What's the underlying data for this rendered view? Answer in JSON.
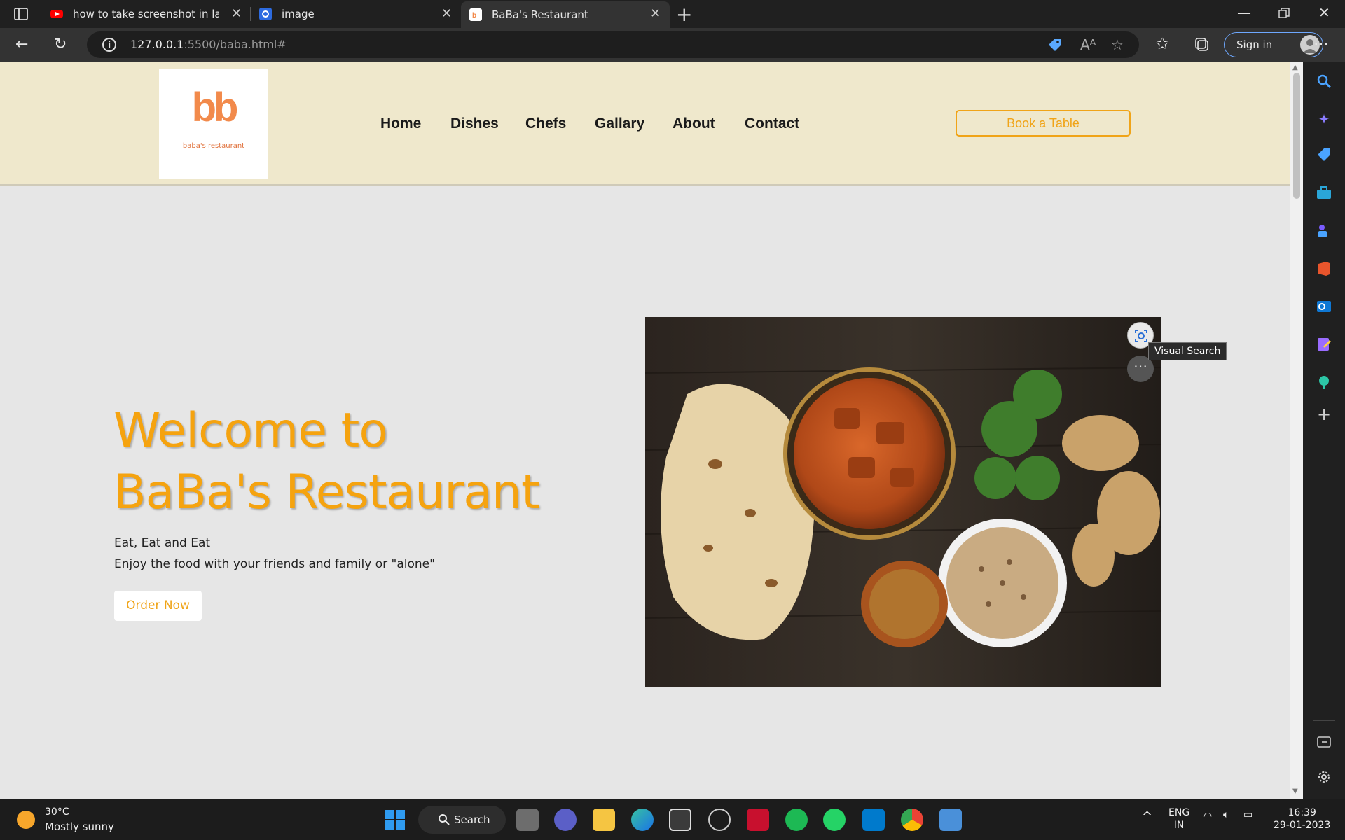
{
  "browser": {
    "tabs": [
      {
        "title": "how to take screenshot in laptop",
        "favicon": "youtube-icon",
        "color": "#ff0000"
      },
      {
        "title": "image",
        "favicon": "image-site-icon",
        "color": "#2d6be0"
      },
      {
        "title": "BaBa's Restaurant",
        "favicon": "restaurant-icon",
        "color": "#f28a4b",
        "active": true
      }
    ],
    "url_host": "127.0.0.1",
    "url_rest": ":5500/baba.html#",
    "sign_in_label": "Sign in"
  },
  "site": {
    "logo": {
      "mark": "bb",
      "subtitle": "baba's restaurant"
    },
    "nav": [
      "Home",
      "Dishes",
      "Chefs",
      "Gallary",
      "About",
      "Contact"
    ],
    "book_button": "Book a Table",
    "hero": {
      "title_line1": "Welcome to",
      "title_line2": "BaBa's Restaurant",
      "line1": "Eat, Eat and Eat",
      "line2": "Enjoy the food with your friends and family or \"alone\"",
      "order_button": "Order Now"
    },
    "image_overlay": {
      "tooltip": "Visual Search"
    }
  },
  "colors": {
    "accent": "#f5a30f",
    "header_bg": "#efe8cc",
    "page_bg": "#e6e6e6",
    "logo": "#f28a4b"
  },
  "taskbar": {
    "weather_temp": "30°C",
    "weather_desc": "Mostly sunny",
    "search_label": "Search",
    "lang_top": "ENG",
    "lang_bottom": "IN",
    "time": "16:39",
    "date": "29-01-2023"
  }
}
